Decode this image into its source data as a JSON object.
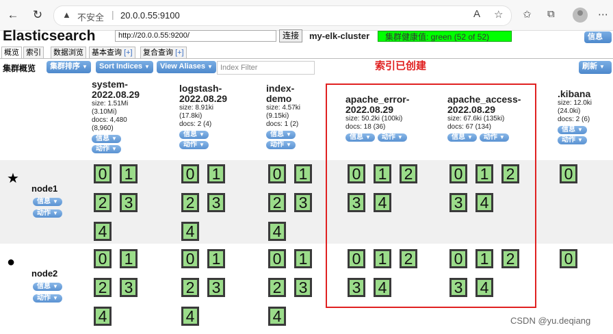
{
  "browser": {
    "security_text": "不安全",
    "url": "20.0.0.55:9100"
  },
  "app": {
    "title": "Elasticsearch",
    "connect_url": "http://20.0.0.55:9200/",
    "connect_button": "连接",
    "cluster_name": "my-elk-cluster",
    "health_text": "集群健康值: green (52 of 52)",
    "info_button": "信息",
    "tabs": [
      {
        "label": "概览",
        "plus": ""
      },
      {
        "label": "索引",
        "plus": ""
      },
      {
        "label": "数据浏览",
        "plus": ""
      },
      {
        "label": "基本查询",
        "plus": "[+]"
      },
      {
        "label": "复合查询",
        "plus": "[+]"
      }
    ],
    "toolbar": {
      "overview_label": "集群概览",
      "sort_cluster": "集群排序",
      "sort_indices": "Sort Indices",
      "view_aliases": "View Aliases",
      "index_filter_placeholder": "Index Filter",
      "refresh": "刷新"
    },
    "annotation": "索引已创建",
    "menu_info": "信息",
    "menu_action": "动作",
    "indices": [
      {
        "name": "system-\n2022.08.29",
        "stats": [
          "size: 1.51Mi",
          "(3.10Mi)",
          "docs: 4,480",
          "(8,960)"
        ]
      },
      {
        "name": "logstash-\n2022.08.29",
        "stats": [
          "size: 8.91ki",
          "(17.8ki)",
          "docs: 2 (4)"
        ]
      },
      {
        "name": "index-\ndemo",
        "stats": [
          "size: 4.57ki",
          "(9.15ki)",
          "docs: 1 (2)"
        ]
      },
      {
        "name": "apache_error-\n2022.08.29",
        "stats": [
          "size: 50.2ki (100ki)",
          "docs: 18 (36)"
        ]
      },
      {
        "name": "apache_access-\n2022.08.29",
        "stats": [
          "size: 67.6ki (135ki)",
          "docs: 67 (134)"
        ]
      },
      {
        "name": ".kibana",
        "stats": [
          "size: 12.0ki",
          "(24.0ki)",
          "docs: 2 (6)"
        ]
      }
    ],
    "nodes": [
      {
        "name": "node1",
        "marker": "★"
      },
      {
        "name": "node2",
        "marker": "●"
      }
    ],
    "shard_labels": [
      "0",
      "1",
      "2",
      "3",
      "4"
    ],
    "watermark": "CSDN @yu.deqiang"
  }
}
